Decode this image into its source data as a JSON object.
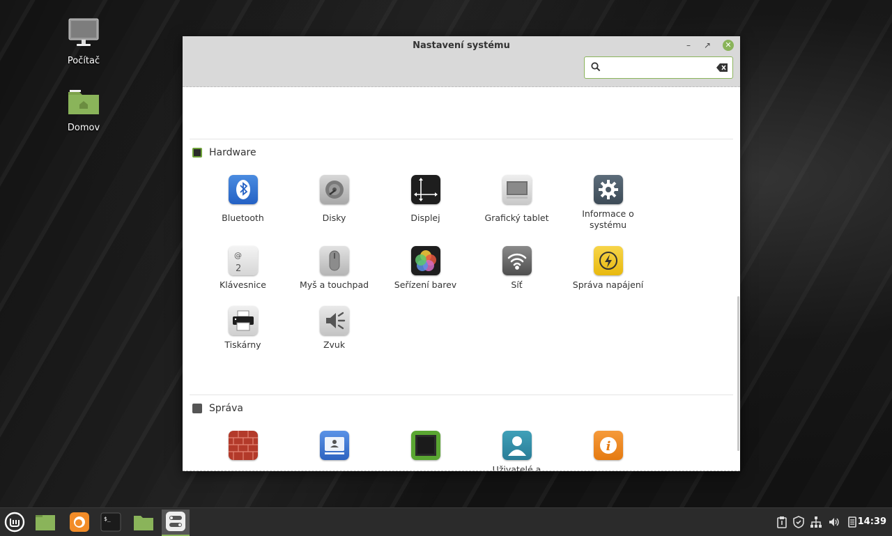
{
  "desktop": {
    "icons": [
      {
        "label": "Počítač"
      },
      {
        "label": "Domov"
      }
    ]
  },
  "window": {
    "title": "Nastavení systému",
    "search": {
      "value": ""
    }
  },
  "sections": [
    {
      "title": "Hardware",
      "items": [
        {
          "label": "Bluetooth",
          "icon": "bluetooth-icon"
        },
        {
          "label": "Disky",
          "icon": "disk-icon"
        },
        {
          "label": "Displej",
          "icon": "display-icon"
        },
        {
          "label": "Grafický tablet",
          "icon": "tablet-icon"
        },
        {
          "label": "Informace o systému",
          "icon": "gear-icon"
        },
        {
          "label": "Klávesnice",
          "icon": "keyboard-icon"
        },
        {
          "label": "Myš a touchpad",
          "icon": "mouse-icon"
        },
        {
          "label": "Seřízení barev",
          "icon": "color-icon"
        },
        {
          "label": "Síť",
          "icon": "wifi-icon"
        },
        {
          "label": "Správa napájení",
          "icon": "power-icon"
        },
        {
          "label": "Tiskárny",
          "icon": "printer-icon"
        },
        {
          "label": "Zvuk",
          "icon": "sound-icon"
        }
      ]
    },
    {
      "title": "Správa",
      "items": [
        {
          "label": "",
          "icon": "firewall-icon"
        },
        {
          "label": "",
          "icon": "login-window-icon"
        },
        {
          "label": "",
          "icon": "driver-icon"
        },
        {
          "label": "Uživatelé a",
          "icon": "user-icon"
        },
        {
          "label": "",
          "icon": "info-icon"
        }
      ]
    }
  ],
  "taskbar": {
    "clock": "14:39"
  },
  "colors": {
    "accent": "#8ab45a",
    "panel": "#2b2b2b",
    "titlebar": "#d9d9d9"
  }
}
